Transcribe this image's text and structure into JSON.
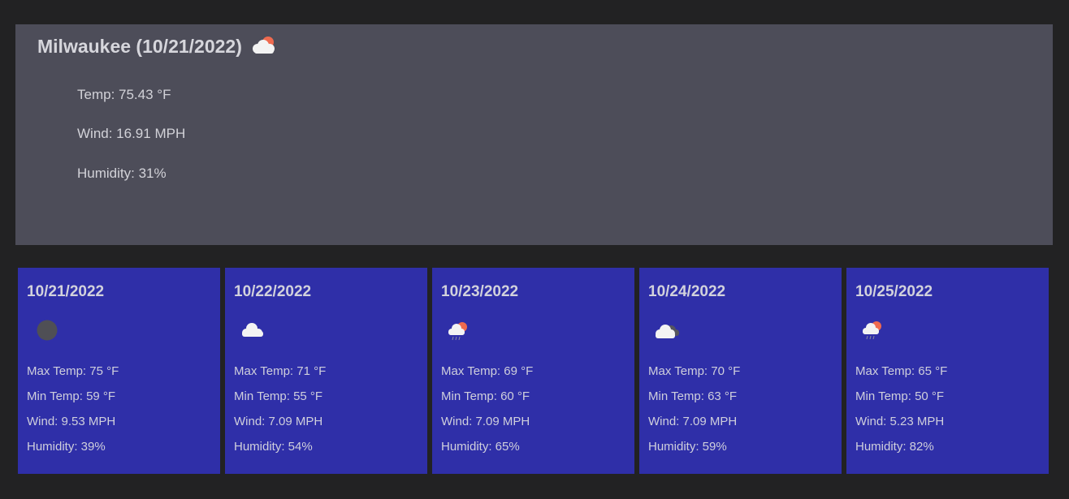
{
  "current": {
    "city_date": "Milwaukee (10/21/2022)",
    "icon": "cloud-sun-icon",
    "temp": "Temp: 75.43 °F",
    "wind": "Wind: 16.91 MPH",
    "humidity": "Humidity: 31%"
  },
  "forecast": [
    {
      "date": "10/21/2022",
      "icon": "moon-icon",
      "max": "Max Temp: 75 °F",
      "min": "Min Temp: 59 °F",
      "wind": "Wind: 9.53 MPH",
      "humidity": "Humidity: 39%"
    },
    {
      "date": "10/22/2022",
      "icon": "cloud-icon",
      "max": "Max Temp: 71 °F",
      "min": "Min Temp: 55 °F",
      "wind": "Wind: 7.09 MPH",
      "humidity": "Humidity: 54%"
    },
    {
      "date": "10/23/2022",
      "icon": "rain-sun-icon",
      "max": "Max Temp: 69 °F",
      "min": "Min Temp: 60 °F",
      "wind": "Wind: 7.09 MPH",
      "humidity": "Humidity: 65%"
    },
    {
      "date": "10/24/2022",
      "icon": "broken-clouds-icon",
      "max": "Max Temp: 70 °F",
      "min": "Min Temp: 63 °F",
      "wind": "Wind: 7.09 MPH",
      "humidity": "Humidity: 59%"
    },
    {
      "date": "10/25/2022",
      "icon": "rain-sun-icon",
      "max": "Max Temp: 65 °F",
      "min": "Min Temp: 50 °F",
      "wind": "Wind: 5.23 MPH",
      "humidity": "Humidity: 82%"
    }
  ]
}
